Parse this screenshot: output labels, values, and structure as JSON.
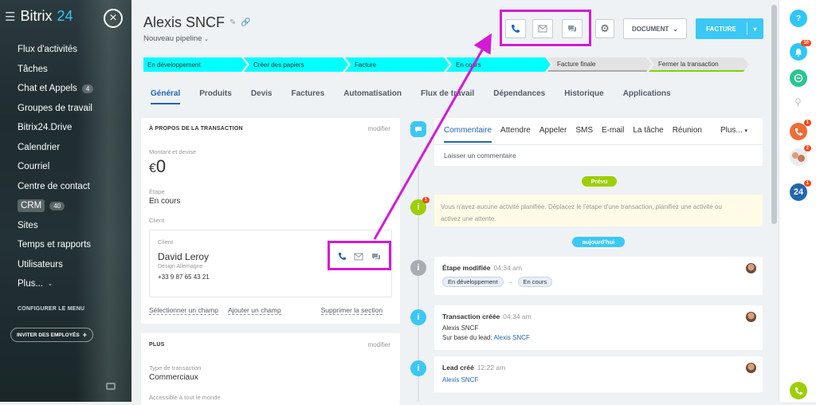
{
  "sidebar": {
    "logo_text": "Bitrix",
    "logo_num": "24",
    "items": [
      {
        "label": "Flux d'activités"
      },
      {
        "label": "Tâches"
      },
      {
        "label": "Chat et Appels",
        "count": "4"
      },
      {
        "label": "Groupes de travail"
      },
      {
        "label": "Bitrix24.Drive"
      },
      {
        "label": "Calendrier"
      },
      {
        "label": "Courriel"
      },
      {
        "label": "Centre de contact"
      },
      {
        "label": "CRM",
        "count": "40"
      },
      {
        "label": "Sites"
      },
      {
        "label": "Temps et rapports"
      },
      {
        "label": "Utilisateurs"
      },
      {
        "label": "Plus..."
      }
    ],
    "configure": "CONFIGURER LE MENU",
    "invite": "INVITER DES EMPLOYÉS"
  },
  "header": {
    "title": "Alexis SNCF",
    "pipeline": "Nouveau pipeline",
    "document": "DOCUMENT",
    "facture": "FACTURE"
  },
  "stages": [
    "En développement",
    "Créer des papiers",
    "Facture",
    "En cours",
    "Facture finale",
    "Fermer la transaction"
  ],
  "tabs": [
    "Général",
    "Produits",
    "Devis",
    "Factures",
    "Automatisation",
    "Flux de travail",
    "Dépendances",
    "Historique",
    "Applications"
  ],
  "about": {
    "title": "À PROPOS DE LA TRANSACTION",
    "modify": "modifier",
    "amount_label": "Montant et devise",
    "currency": "€",
    "amount": "0",
    "stage_label": "Étape",
    "stage": "En cours",
    "client_label": "Client",
    "client_inner_label": "Client",
    "client_name": "David Leroy",
    "client_company": "Design Allemagne",
    "client_phone": "+33 9 87 65 43 21",
    "select_field": "Sélectionner un champ",
    "add_field": "Ajouter un champ",
    "remove_section": "Supprimer la section"
  },
  "plus_card": {
    "title": "PLUS",
    "modify": "modifier",
    "type_label": "Type de transaction",
    "type": "Commerciaux",
    "access_label": "Accessible à tout le monde"
  },
  "activity": {
    "tabs": [
      "Commentaire",
      "Attendre",
      "Appeler",
      "SMS",
      "E-mail",
      "La tâche",
      "Réunion",
      "Plus..."
    ],
    "comment_placeholder": "Laisser un commentaire",
    "planned_pill": "Prévu",
    "planned_text": "Vous n'avez aucune activité planifiée. Déplacez le l'étape d'une transaction, planifiez une activité ou activez une attente.",
    "planned_badge": "1",
    "today_pill": "aujourd'hui",
    "entries": [
      {
        "title": "Étape modifiée",
        "time": "04:34 am",
        "from": "En développement",
        "to": "En cours"
      },
      {
        "title": "Transaction créée",
        "time": "04:34 am",
        "line1": "Alexis SNCF",
        "line2_prefix": "Sur base du lead:",
        "line2_link": "Alexis SNCF"
      },
      {
        "title": "Lead créé",
        "time": "12:22 am",
        "line1": "Alexis SNCF"
      }
    ]
  },
  "right_bar": {
    "bell_badge": "10",
    "phone_badge": "1",
    "people_badge": "2",
    "b24_badge": "1",
    "b24_label": "24"
  },
  "colors": {
    "accent": "#3bc8f5",
    "highlight": "#d41ad4",
    "stage_active": "#00ffff",
    "link": "#2067b0"
  }
}
